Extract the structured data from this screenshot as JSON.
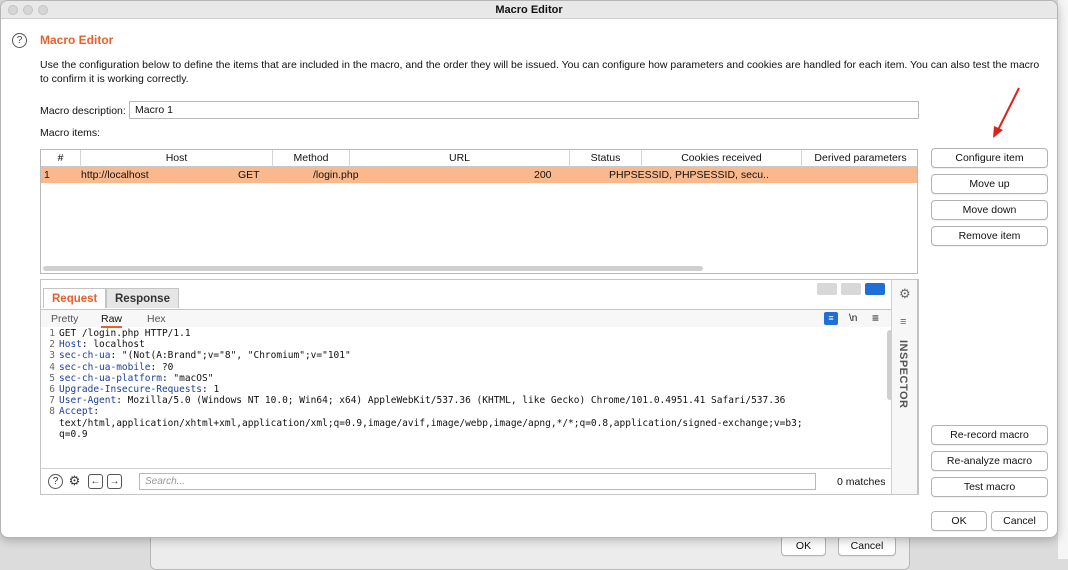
{
  "window": {
    "title": "Macro Editor"
  },
  "heading": "Macro Editor",
  "description": "Use the configuration below to define the items that are included in the macro, and the order they will be issued. You can configure how parameters and cookies are handled for each item. You can also test the macro to confirm it is working correctly.",
  "macro_description_label": "Macro description:",
  "macro_description_value": "Macro 1",
  "macro_items_label": "Macro items:",
  "table": {
    "headers": [
      "#",
      "Host",
      "Method",
      "URL",
      "Status",
      "Cookies received",
      "Derived parameters"
    ],
    "rows": [
      {
        "num": "1",
        "host": "http://localhost",
        "method": "GET",
        "url": "/login.php",
        "status": "200",
        "cookies": "PHPSESSID, PHPSESSID, secu...",
        "derived": ""
      }
    ]
  },
  "side_buttons": {
    "configure_item": "Configure item",
    "move_up": "Move up",
    "move_down": "Move down",
    "remove_item": "Remove item",
    "re_record": "Re-record macro",
    "re_analyze": "Re-analyze macro",
    "test_macro": "Test macro",
    "ok": "OK",
    "cancel": "Cancel"
  },
  "editor": {
    "tabs": [
      "Request",
      "Response"
    ],
    "subtabs": [
      "Pretty",
      "Raw",
      "Hex"
    ],
    "newline_toggle": "\\n",
    "inspector_label": "INSPECTOR",
    "lines": [
      {
        "n": "1",
        "key": "",
        "val": "GET /login.php HTTP/1.1"
      },
      {
        "n": "2",
        "key": "Host",
        "val": ": localhost"
      },
      {
        "n": "3",
        "key": "sec-ch-ua",
        "val": ": \"(Not(A:Brand\";v=\"8\", \"Chromium\";v=\"101\""
      },
      {
        "n": "4",
        "key": "sec-ch-ua-mobile",
        "val": ": ?0"
      },
      {
        "n": "5",
        "key": "sec-ch-ua-platform",
        "val": ": \"macOS\""
      },
      {
        "n": "6",
        "key": "Upgrade-Insecure-Requests",
        "val": ": 1"
      },
      {
        "n": "7",
        "key": "User-Agent",
        "val": ": Mozilla/5.0 (Windows NT 10.0; Win64; x64) AppleWebKit/537.36 (KHTML, like Gecko) Chrome/101.0.4951.41 Safari/537.36"
      },
      {
        "n": "8",
        "key": "Accept",
        "val": ":"
      },
      {
        "n": "",
        "key": "",
        "val": "text/html,application/xhtml+xml,application/xml;q=0.9,image/avif,image/webp,image/apng,*/*;q=0.8,application/signed-exchange;v=b3;"
      },
      {
        "n": "",
        "key": "",
        "val": "q=0.9"
      }
    ],
    "search_placeholder": "Search...",
    "matches": "0 matches"
  },
  "background_window": {
    "ok": "OK",
    "cancel": "Cancel"
  },
  "colors": {
    "accent": "#e8612c",
    "selected_row": "#f9b98c",
    "header_key": "#1b3f9e",
    "arrow": "#e0201a"
  }
}
